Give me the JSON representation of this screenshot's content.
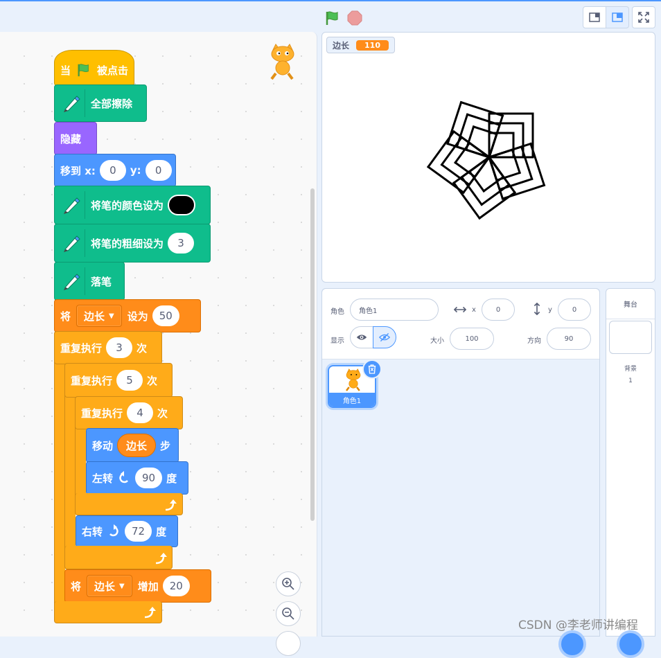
{
  "toolbar": {
    "green_flag": "green-flag-icon",
    "stop": "stop-icon"
  },
  "blocks": {
    "when_flag": {
      "prefix": "当",
      "suffix": "被点击"
    },
    "erase_all": "全部擦除",
    "hide": "隐藏",
    "goto": {
      "label": "移到 x:",
      "x": "0",
      "y_label": "y:",
      "y": "0"
    },
    "set_pen_color": {
      "label": "将笔的颜色设为",
      "color": "#000000"
    },
    "set_pen_size": {
      "label": "将笔的粗细设为",
      "value": "3"
    },
    "pen_down": "落笔",
    "set_var": {
      "prefix": "将",
      "var": "边长",
      "mid": "设为",
      "value": "50"
    },
    "repeat1": {
      "label": "重复执行",
      "count": "3",
      "suffix": "次"
    },
    "repeat2": {
      "label": "重复执行",
      "count": "5",
      "suffix": "次"
    },
    "repeat3": {
      "label": "重复执行",
      "count": "4",
      "suffix": "次"
    },
    "move": {
      "label": "移动",
      "var": "边长",
      "suffix": "步"
    },
    "turn_left": {
      "label": "左转",
      "value": "90",
      "suffix": "度"
    },
    "turn_right": {
      "label": "右转",
      "value": "72",
      "suffix": "度"
    },
    "change_var": {
      "prefix": "将",
      "var": "边长",
      "mid": "增加",
      "value": "20"
    }
  },
  "stage": {
    "monitor": {
      "label": "边长",
      "value": "110"
    }
  },
  "sprite_info": {
    "sprite_label": "角色",
    "sprite_name": "角色1",
    "x_label": "x",
    "x": "0",
    "y_label": "y",
    "y": "0",
    "show_label": "显示",
    "size_label": "大小",
    "size": "100",
    "direction_label": "方向",
    "direction": "90"
  },
  "sprites": [
    {
      "name": "角色1"
    }
  ],
  "stage_pane": {
    "title": "舞台",
    "backdrop_label": "背景",
    "backdrop_count": "1"
  },
  "watermark": "CSDN @李老师讲编程"
}
